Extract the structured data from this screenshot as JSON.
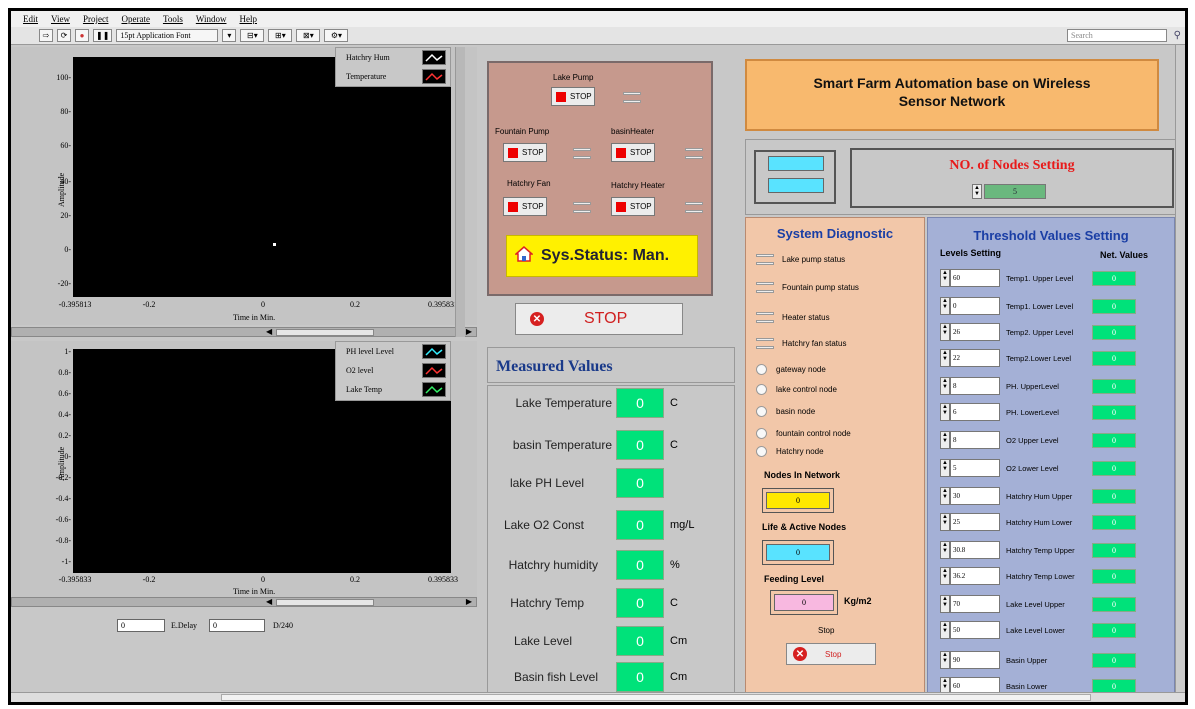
{
  "menu": [
    "Edit",
    "View",
    "Project",
    "Operate",
    "Tools",
    "Window",
    "Help"
  ],
  "toolbar": {
    "font_label": "15pt Application Font",
    "search_placeholder": "Search"
  },
  "graph1": {
    "legend": [
      {
        "name": "Hatchry Hum"
      },
      {
        "name": "Temperature"
      }
    ],
    "yticks": [
      "100-",
      "80-",
      "60-",
      "40-",
      "20-",
      "0-",
      "-20-"
    ],
    "xticks": [
      "-0.395813",
      "-0.2",
      "0",
      "0.2",
      "0.395831"
    ],
    "xlabel": "Time in Min.",
    "ylabel": "Amplitude"
  },
  "graph2": {
    "legend": [
      {
        "name": "PH level Level"
      },
      {
        "name": "O2 level"
      },
      {
        "name": "Lake Temp"
      }
    ],
    "yticks": [
      "1-",
      "0.8-",
      "0.6-",
      "0.4-",
      "0.2-",
      "0-",
      "-0.2-",
      "-0.4-",
      "-0.6-",
      "-0.8-",
      "-1-"
    ],
    "xticks": [
      "-0.395833",
      "-0.2",
      "0",
      "0.2",
      "0.395833"
    ],
    "xlabel": "Time in Min.",
    "ylabel": "Amplitude"
  },
  "delay": {
    "value1": "0",
    "label": "E.Delay",
    "value2": "0",
    "suffix": "D/240"
  },
  "pumps": {
    "lake_pump": "Lake Pump",
    "fountain_pump": "Fountain Pump",
    "basin_heater": "basinHeater",
    "hatchry_fan": "Hatchry Fan",
    "hatchry_heater": "Hatchry Heater",
    "button_text": "STOP"
  },
  "sys_status": "Sys.Status: Man.",
  "big_stop": "STOP",
  "measured": {
    "title": "Measured Values",
    "rows": [
      {
        "name": "Lake Temperature",
        "value": "0",
        "unit": "C"
      },
      {
        "name": "basin Temperature",
        "value": "0",
        "unit": "C"
      },
      {
        "name": "lake PH Level",
        "value": "0",
        "unit": ""
      },
      {
        "name": "Lake O2 Const",
        "value": "0",
        "unit": "mg/L"
      },
      {
        "name": "Hatchry humidity",
        "value": "0",
        "unit": "%"
      },
      {
        "name": "Hatchry Temp",
        "value": "0",
        "unit": "C"
      },
      {
        "name": "Lake Level",
        "value": "0",
        "unit": "Cm"
      },
      {
        "name": "Basin fish Level",
        "value": "0",
        "unit": "Cm"
      }
    ]
  },
  "title": {
    "line1": "Smart Farm Automation base on Wireless",
    "line2": "Sensor Network"
  },
  "nodes_setting": {
    "title": "NO. of Nodes Setting",
    "value": "5"
  },
  "diagnostic": {
    "title": "System Diagnostic",
    "status_items": [
      "Lake pump status",
      "Fountain pump status",
      "Heater status",
      "Hatchry fan status"
    ],
    "nodes": [
      "gateway node",
      "lake control node",
      "basin node",
      "fountain control node",
      "Hatchry node"
    ],
    "nodes_in_network_label": "Nodes In Network",
    "nodes_in_network": "0",
    "life_active_label": "Life & Active Nodes",
    "life_active": "0",
    "feeding_label": "Feeding Level",
    "feeding": "0",
    "feeding_unit": "Kg/m2",
    "stop_label": "Stop",
    "stop_button": "Stop",
    "colors": {
      "nodes_in_network": "#ffe800",
      "life_active": "#59e3ff",
      "feeding": "#f8b8e0"
    }
  },
  "threshold": {
    "title": "Threshold Values Setting",
    "levels_header": "Levels Setting",
    "net_header": "Net. Values",
    "rows": [
      {
        "setting": "60",
        "name": "Temp1. Upper Level",
        "net": "0"
      },
      {
        "setting": "0",
        "name": "Temp1. Lower Level",
        "net": "0"
      },
      {
        "setting": "26",
        "name": "Temp2. Upper Level",
        "net": "0"
      },
      {
        "setting": "22",
        "name": "Temp2.Lower Level",
        "net": "0"
      },
      {
        "setting": "8",
        "name": "PH. UpperLevel",
        "net": "0"
      },
      {
        "setting": "6",
        "name": "PH. LowerLevel",
        "net": "0"
      },
      {
        "setting": "8",
        "name": "O2 Upper Level",
        "net": "0"
      },
      {
        "setting": "5",
        "name": "O2 Lower Level",
        "net": "0"
      },
      {
        "setting": "30",
        "name": "Hatchry Hum Upper",
        "net": "0"
      },
      {
        "setting": "25",
        "name": "Hatchry Hum Lower",
        "net": "0"
      },
      {
        "setting": "30.8",
        "name": "Hatchry Temp Upper",
        "net": "0"
      },
      {
        "setting": "36.2",
        "name": "Hatchry Temp Lower",
        "net": "0"
      },
      {
        "setting": "70",
        "name": "Lake Level Upper",
        "net": "0"
      },
      {
        "setting": "50",
        "name": "Lake Level Lower",
        "net": "0"
      },
      {
        "setting": "90",
        "name": "Basin Upper",
        "net": "0"
      },
      {
        "setting": "60",
        "name": "Basin Lower",
        "net": "0"
      }
    ]
  }
}
